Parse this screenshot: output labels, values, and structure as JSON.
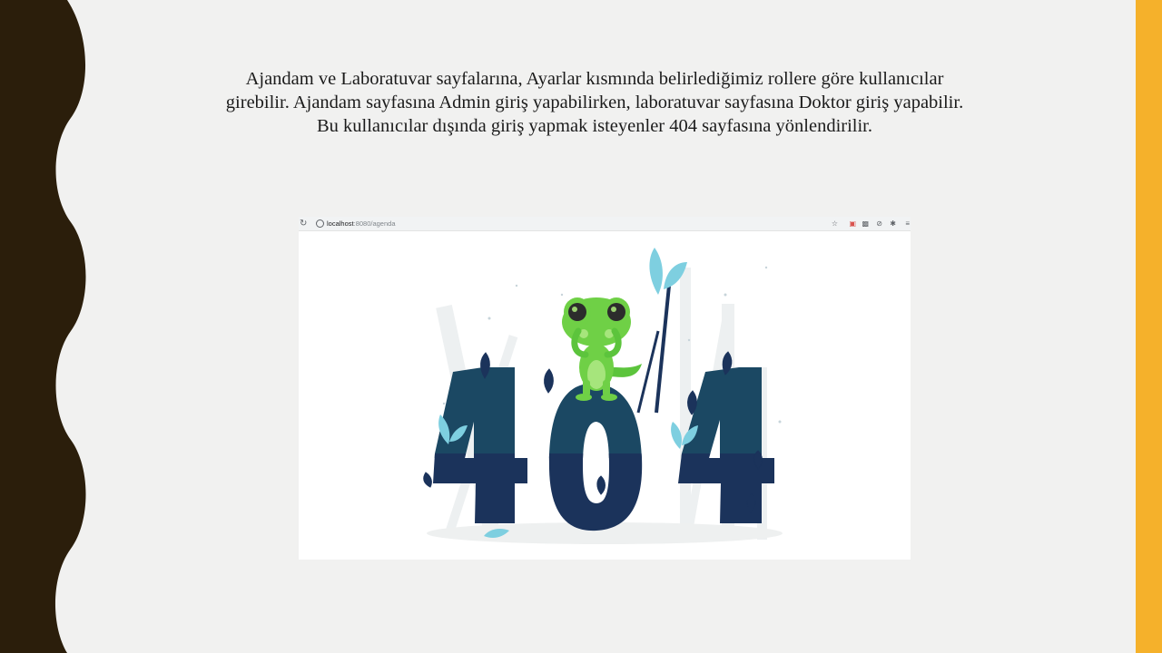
{
  "slide": {
    "caption_lines": [
      "Ajandam ve Laboratuvar sayfalarına, Ayarlar kısmında belirlediğimiz rollere göre kullanıcılar",
      "girebilir. Ajandam sayfasına Admin giriş yapabilirken, laboratuvar sayfasına Doktor giriş yapabilir.",
      "Bu kullanıcılar dışında giriş yapmak isteyenler 404 sayfasına yönlendirilir."
    ],
    "colors": {
      "background": "#f1f1f0",
      "wave_band": "#2b1e0b",
      "accent_bar": "#f5b12b"
    }
  },
  "browser": {
    "url_host": "localhost",
    "url_path": ":8080/agenda",
    "icons": [
      "reload-icon",
      "site-info-icon",
      "star-icon",
      "extension-icon",
      "extension-icon",
      "block-icon",
      "puzzle-icon",
      "reading-list-icon"
    ]
  },
  "error_page": {
    "code": "404",
    "colors": {
      "digits_top": "#1b4863",
      "digits_bottom": "#1b335b",
      "frog": "#6fd046",
      "leaf_light": "#7ecfe0",
      "ground": "#eef0f0"
    }
  }
}
